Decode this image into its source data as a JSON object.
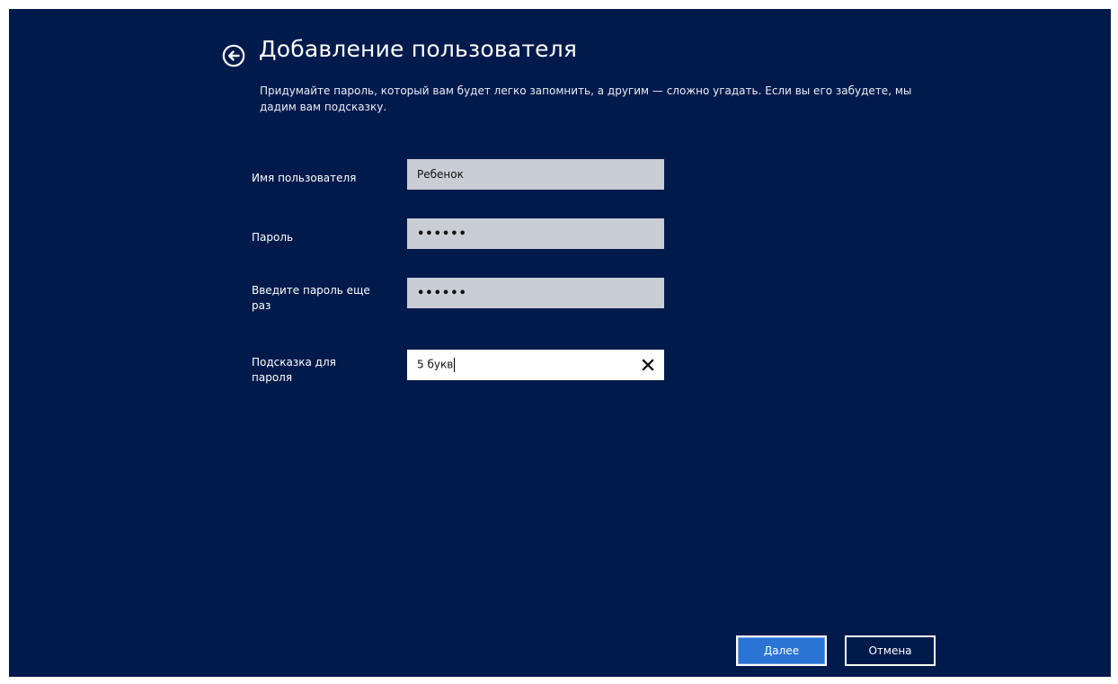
{
  "header": {
    "title": "Добавление пользователя",
    "description": "Придумайте пароль, который вам будет легко запомнить, а другим — сложно угадать. Если вы его забудете, мы дадим вам подсказку."
  },
  "form": {
    "username": {
      "label": "Имя пользователя",
      "value": "Ребенок"
    },
    "password": {
      "label": "Пароль",
      "value": "••••••"
    },
    "password_confirm": {
      "label": "Введите пароль еще раз",
      "value": "••••••"
    },
    "hint": {
      "label": "Подсказка для пароля",
      "value": "5 букв"
    }
  },
  "buttons": {
    "next": "Далее",
    "cancel": "Отмена"
  },
  "icons": {
    "back": "back-arrow-circle-icon",
    "clear": "close-icon"
  },
  "colors": {
    "background": "#001a4c",
    "accent": "#2a74d4",
    "field_inactive": "#c9cdd4",
    "field_active": "#ffffff"
  }
}
